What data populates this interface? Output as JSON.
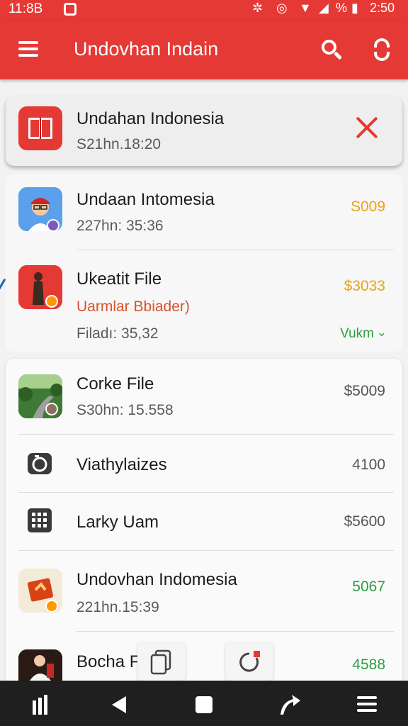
{
  "status_bar": {
    "time": "11:8В",
    "battery_percent": "%",
    "clock_right": "2:50",
    "icons": [
      "notification-icon",
      "settings-gear-icon",
      "alarm-icon",
      "wifi-icon",
      "signal-icon",
      "battery-icon"
    ]
  },
  "app_bar": {
    "title": "Undovhan Indain",
    "icons": [
      "menu-icon",
      "search-icon",
      "sync-icon"
    ],
    "color": "#e53935"
  },
  "items": [
    {
      "title": "Undahan Indonesia",
      "subtitle": "S21hn.18:20",
      "icon": "book-icon"
    },
    {
      "title": "Undaan Intomesia",
      "subtitle": "227hn: 35:36",
      "amount": "S009",
      "amount_color": "#e8a317",
      "icon": "avatar-icon"
    },
    {
      "title": "Ukeatit File",
      "subtitle": "Uarmlar Bbiader)",
      "subtitle2": "Filadı: 35,32",
      "amount": "$3033",
      "amount_color": "#e8a317",
      "extra_link": "Vukm",
      "extra_color": "#2e9e3e",
      "icon": "person-photo-icon"
    },
    {
      "title": "Corke File",
      "subtitle": "S30hn: 15.558",
      "amount": "$5009",
      "amount_color": "#555555",
      "icon": "road-photo-icon"
    },
    {
      "title": "Viathylaizes",
      "amount": "4100",
      "amount_color": "#555555",
      "icon": "camera-icon"
    },
    {
      "title": "Larky Uam",
      "amount": "$5600",
      "amount_color": "#555555",
      "icon": "calculator-icon"
    },
    {
      "title": "Undovhan Indomesia",
      "subtitle": "221hn.15:39",
      "amount": "5067",
      "amount_color": "#2e9e3e",
      "icon": "gift-card-icon"
    },
    {
      "title": "Bocha Fi:",
      "amount": "4588",
      "amount_color": "#2e9e3e",
      "icon": "portrait-photo-icon"
    }
  ],
  "nav_bar": {
    "icons": [
      "recents-icon",
      "back-icon",
      "home-icon",
      "share-icon",
      "menu-icon"
    ]
  }
}
